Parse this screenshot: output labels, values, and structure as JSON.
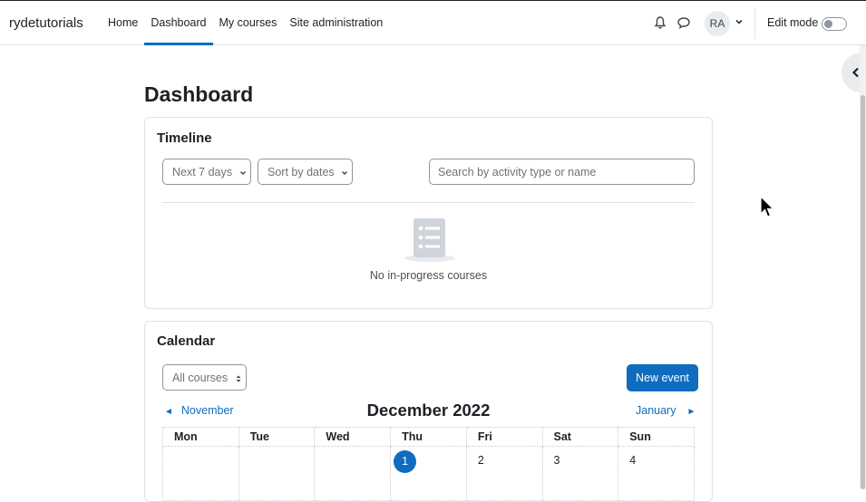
{
  "navbar": {
    "brand": "rydetutorials",
    "links": [
      {
        "label": "Home",
        "active": false
      },
      {
        "label": "Dashboard",
        "active": true
      },
      {
        "label": "My courses",
        "active": false
      },
      {
        "label": "Site administration",
        "active": false
      }
    ],
    "notifications_icon": "bell-icon",
    "messages_icon": "chat-bubble-icon",
    "avatar_initials": "RA",
    "edit_mode_label": "Edit mode",
    "edit_mode_on": false
  },
  "page": {
    "title": "Dashboard"
  },
  "timeline": {
    "title": "Timeline",
    "filter_label": "Next 7 days",
    "sort_label": "Sort by dates",
    "search_placeholder": "Search by activity type or name",
    "empty_text": "No in-progress courses"
  },
  "calendar": {
    "title": "Calendar",
    "course_filter": "All courses",
    "new_event_label": "New event",
    "prev_month": "November",
    "next_month": "January",
    "current_month": "December 2022",
    "weekdays": [
      "Mon",
      "Tue",
      "Wed",
      "Thu",
      "Fri",
      "Sat",
      "Sun"
    ],
    "first_week": [
      "",
      "",
      "",
      "1",
      "2",
      "3",
      "4"
    ],
    "today": "1"
  },
  "colors": {
    "accent": "#0f6cbf",
    "border": "#dee2e6",
    "text": "#1d2125"
  }
}
